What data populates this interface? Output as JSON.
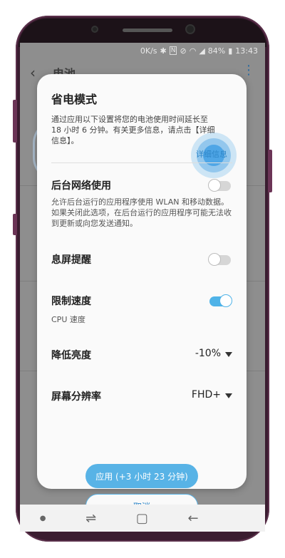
{
  "status_bar": {
    "speed": "0K/s",
    "battery": "84%",
    "time": "13:43"
  },
  "background": {
    "title": "电池"
  },
  "dialog": {
    "title": "省电模式",
    "description": "通过应用以下设置将您的电池使用时间延长至 18 小时 6 分钟。有关更多信息，请点击【详细信息】。",
    "detail_link": "详细信息",
    "background_network": {
      "label": "后台网络使用",
      "description": "允许后台运行的应用程序使用 WLAN 和移动数据。如果关闭此选项，在后台运行的应用程序可能无法收到更新或向您发送通知。",
      "enabled": false
    },
    "screen_off_reminder": {
      "label": "息屏提醒",
      "enabled": false
    },
    "limit_speed": {
      "label": "限制速度",
      "sub": "CPU 速度",
      "enabled": true
    },
    "reduce_brightness": {
      "label": "降低亮度",
      "value": "-10%"
    },
    "screen_resolution": {
      "label": "屏幕分辨率",
      "value": "FHD+"
    },
    "apply_button": "应用 (+3 小时 23 分钟)",
    "cancel_button": "取消"
  },
  "icons": {
    "back": "back-arrow-icon",
    "more": "more-vertical-icon",
    "recents": "recents-icon",
    "home": "home-icon",
    "nav_back": "nav-back-icon"
  },
  "colors": {
    "accent": "#58b3e6",
    "link": "#2e86c8",
    "overlay": "#8e8e8e"
  }
}
